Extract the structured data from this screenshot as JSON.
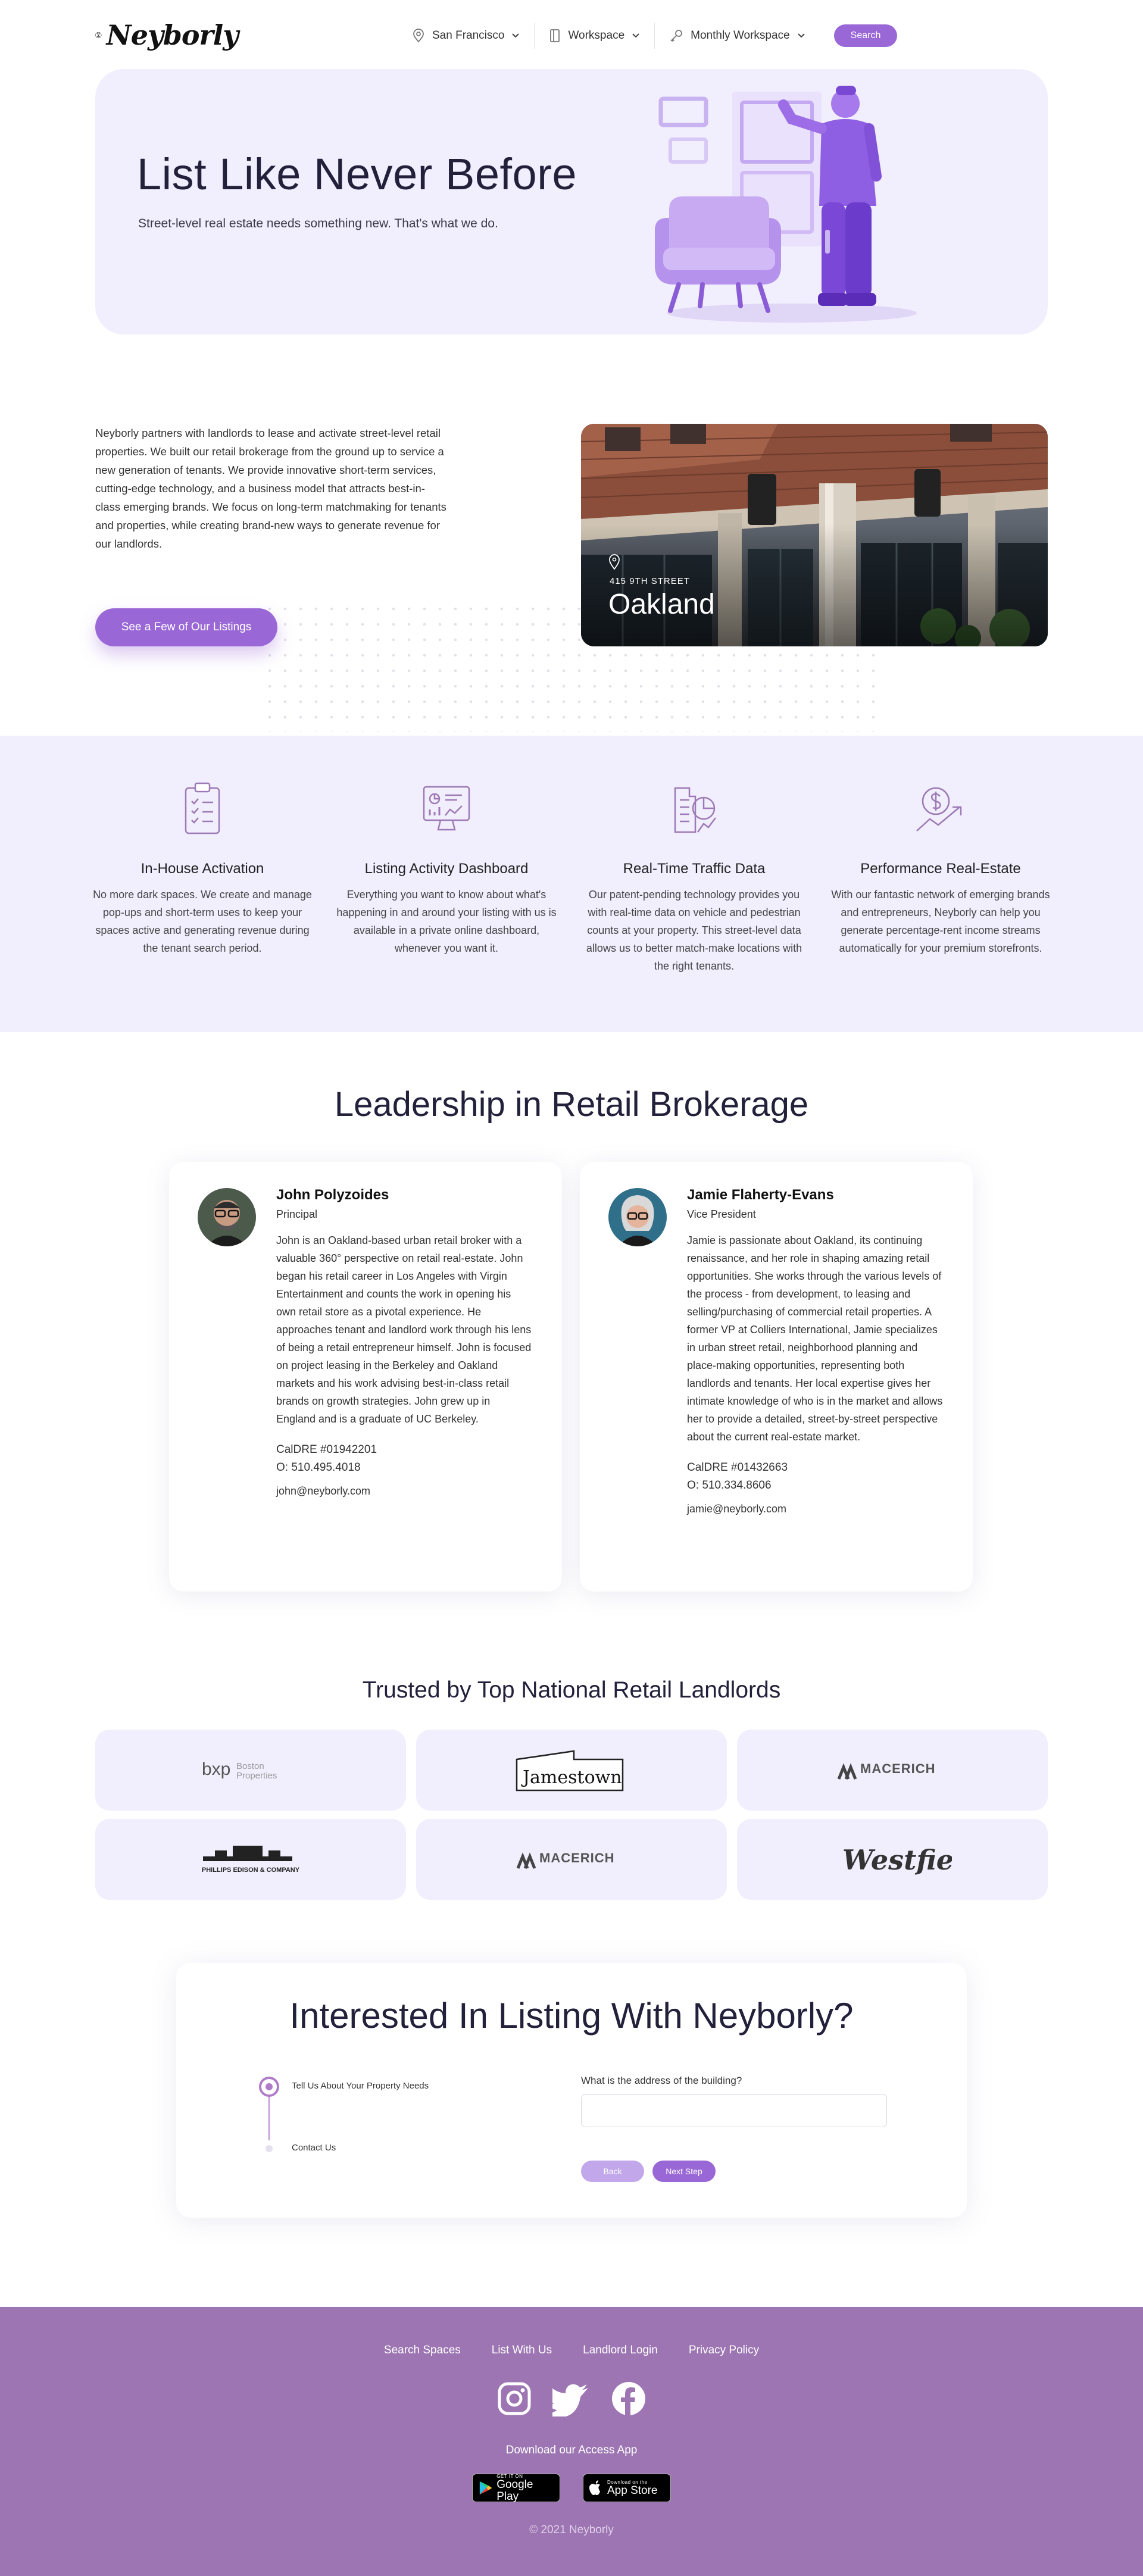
{
  "brand": {
    "name": "Neyborly",
    "accent_color": "#9a68d6",
    "tint_color": "#f1eefd",
    "footer_color": "#9c75b2"
  },
  "nav": {
    "location": "San Francisco",
    "space_type": "Workspace",
    "term": "Monthly Workspace",
    "search_label": "Search"
  },
  "hero": {
    "title": "List Like Never Before",
    "subtitle": "Street-level real estate needs something new. That's what we do."
  },
  "about": {
    "body": "Neyborly partners with landlords to lease and activate street-level retail properties. We built our retail brokerage from the ground up to service a new generation of tenants. We provide innovative short-term services, cutting-edge technology, and a business model that attracts best-in-class emerging brands. We focus on long-term matchmaking for tenants and properties, while creating brand-new ways to generate revenue for our landlords.",
    "button_label": "See a Few of Our Listings",
    "listing_address": "415 9TH STREET",
    "listing_city": "Oakland"
  },
  "features": [
    {
      "icon": "clipboard-checklist-icon",
      "title": "In-House Activation",
      "text": "No more dark spaces. We create and manage pop-ups and short-term uses to keep your spaces active and generating revenue during the tenant search period."
    },
    {
      "icon": "dashboard-monitor-icon",
      "title": "Listing Activity Dashboard",
      "text": "Everything you want to know about what's happening in and around your listing with us is available in a private online dashboard, whenever you want it."
    },
    {
      "icon": "traffic-analytics-icon",
      "title": "Real-Time Traffic Data",
      "text": "Our patent-pending technology provides you with real-time data on vehicle and pedestrian counts at your property. This street-level data allows us to better match-make locations with the right tenants."
    },
    {
      "icon": "dollar-growth-icon",
      "title": "Performance Real-Estate",
      "text": "With our fantastic network of emerging brands and entrepreneurs, Neyborly can help you generate percentage-rent income streams automatically for your premium storefronts."
    }
  ],
  "leadership": {
    "title": "Leadership in Retail Brokerage",
    "people": [
      {
        "name": "John Polyzoides",
        "role": "Principal",
        "bio": "John is an Oakland-based urban retail broker with a valuable 360° perspective on retail real-estate. John began his retail career in Los Angeles with Virgin Entertainment and counts the work in opening his own retail store as a pivotal experience. He approaches tenant and landlord work through his lens of being a retail entrepreneur himself. John is focused on project leasing in the Berkeley and Oakland markets and his work advising best-in-class retail brands on growth strategies. John grew up in England and is a graduate of UC Berkeley.",
        "license": "CalDRE #01942201",
        "phone": "O: 510.495.4018",
        "email": "john@neyborly.com"
      },
      {
        "name": "Jamie Flaherty-Evans",
        "role": "Vice President",
        "bio": "Jamie is passionate about Oakland, its continuing renaissance, and her role in shaping amazing retail opportunities. She works through the various levels of the process - from development, to leasing and selling/purchasing of commercial retail properties. A former VP at Colliers International, Jamie specializes in urban street retail, neighborhood planning and place-making opportunities, representing both landlords and tenants. Her local expertise gives her intimate knowledge of who is in the market and allows her to provide a detailed, street-by-street perspective about the current real-estate market.",
        "license": "CalDRE #01432663",
        "phone": "O: 510.334.8606",
        "email": "jamie@neyborly.com"
      }
    ]
  },
  "trusted": {
    "title": "Trusted by Top National Retail Landlords",
    "logos": [
      {
        "icon": "bxp-logo",
        "text_a": "bxp",
        "text_b": "Boston",
        "text_c": "Properties"
      },
      {
        "icon": "jamestown-logo",
        "text_a": "Jamestown"
      },
      {
        "icon": "macerich-logo",
        "text_a": "MACERICH"
      },
      {
        "icon": "phillips-edison-logo",
        "text_a": "PHILLIPS EDISON & COMPANY"
      },
      {
        "icon": "macerich-logo",
        "text_a": "MACERICH"
      },
      {
        "icon": "westfield-logo",
        "text_a": "Westfield"
      }
    ]
  },
  "form": {
    "title": "Interested In Listing With Neyborly?",
    "steps": [
      "Tell Us About Your Property Needs",
      "Contact Us"
    ],
    "question": "What is the address of the building?",
    "input_value": "",
    "input_placeholder": "",
    "back_label": "Back",
    "next_label": "Next Step"
  },
  "footer": {
    "links": [
      "Search Spaces",
      "List With Us",
      "Landlord Login",
      "Privacy Policy"
    ],
    "socials": [
      "instagram-icon",
      "twitter-icon",
      "facebook-icon"
    ],
    "download_label": "Download our Access App",
    "google_small": "GET IT ON",
    "google_big": "Google Play",
    "apple_small": "Download on the",
    "apple_big": "App Store",
    "copyright": "© 2021 Neyborly"
  }
}
